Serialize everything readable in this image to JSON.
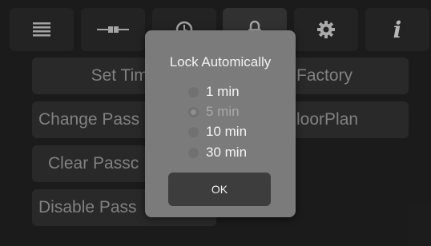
{
  "toolbar": {
    "tabs": [
      {
        "icon": "list-icon"
      },
      {
        "icon": "connection-icon"
      },
      {
        "icon": "clock-icon"
      },
      {
        "icon": "lock-icon",
        "active": true
      },
      {
        "icon": "gear-icon"
      },
      {
        "icon": "info-icon",
        "glyph": "i"
      }
    ]
  },
  "settings_grid": {
    "set_time_label": "Set Time",
    "factory_label": "Factory",
    "change_password_label": "Change Pass",
    "floorplan_label": "loorPlan",
    "clear_password_label": "Clear Passc",
    "disable_password_label": "Disable Pass"
  },
  "dialog": {
    "title": "Lock Automically",
    "options": [
      {
        "label": "1 min",
        "selected": false
      },
      {
        "label": "5 min",
        "selected": true
      },
      {
        "label": "10 min",
        "selected": false
      },
      {
        "label": "30 min",
        "selected": false
      }
    ],
    "ok_label": "OK"
  }
}
